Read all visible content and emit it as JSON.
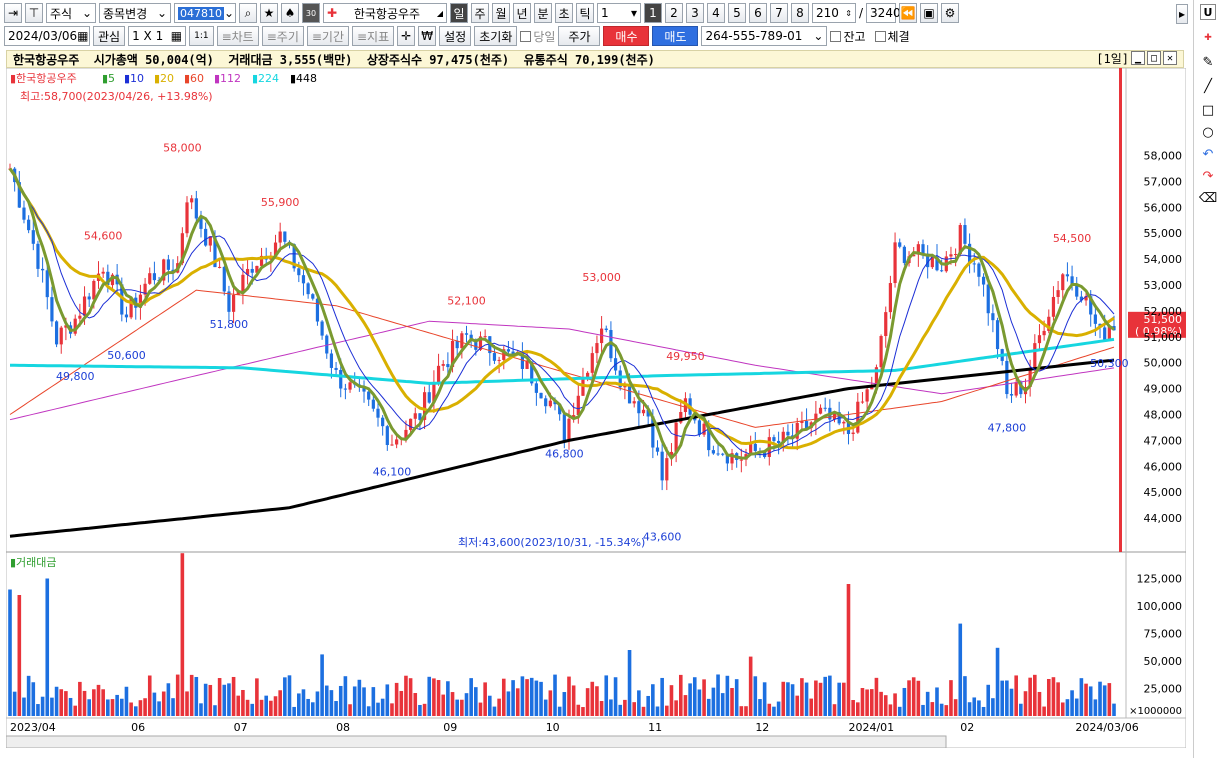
{
  "toolbar1": {
    "market": "주식",
    "change": "종목변경",
    "code": "047810",
    "stock_name": "한국항공우주",
    "periods": [
      "일",
      "주",
      "월",
      "년",
      "분",
      "초",
      "틱"
    ],
    "period_count": "1",
    "nums": [
      "1",
      "2",
      "3",
      "4",
      "5",
      "6",
      "7",
      "8"
    ],
    "count": "210",
    "slash": "/",
    "total": "3240",
    "u_label": "U"
  },
  "toolbar2": {
    "date": "2024/03/06",
    "watch": "관심",
    "grid": "1 X 1",
    "one": "1:1",
    "chart": "≡차트",
    "cycle": "≡주기",
    "range": "≡기간",
    "indicator": "≡지표",
    "won": "₩",
    "settings": "설정",
    "reset": "초기화",
    "sameday": "당일",
    "price": "주가",
    "buy": "매수",
    "sell": "매도",
    "account": "264-555-789-01",
    "balance": "잔고",
    "fill": "체결"
  },
  "info": {
    "text": "한국항공우주  시가총액 50,004(억)  거래대금 3,555(백만)  상장주식수 97,475(천주)  유통주식 70,199(천주)",
    "period": "[1일]"
  },
  "chart_data": [
    {
      "type": "line",
      "title": "",
      "legend_name": "한국항공우주",
      "ma": [
        {
          "name": "5",
          "color": "#2f9e2f"
        },
        {
          "name": "10",
          "color": "#1c2fd6"
        },
        {
          "name": "20",
          "color": "#d9b000"
        },
        {
          "name": "60",
          "color": "#e8452a"
        },
        {
          "name": "112",
          "color": "#c035c0"
        },
        {
          "name": "224",
          "color": "#16d6e0"
        },
        {
          "name": "448",
          "color": "#000000"
        }
      ],
      "high_note": "최고:58,700(2023/04/26, +13.98%)",
      "low_note": "최저:43,600(2023/10/31, -15.34%)",
      "ylim": [
        43000,
        59600
      ],
      "yticks": [
        44000,
        45000,
        46000,
        47000,
        48000,
        49000,
        50000,
        51000,
        52000,
        53000,
        54000,
        55000,
        56000,
        57000,
        58000
      ],
      "ytick_labels": [
        "44,000",
        "45,000",
        "46,000",
        "47,000",
        "48,000",
        "49,000",
        "50,000",
        "51,000",
        "52,000",
        "53,000",
        "54,000",
        "55,000",
        "56,000",
        "57,000",
        "58,000"
      ],
      "current_price": "51,500",
      "current_change": "( 0.98%)",
      "price_annotations": [
        {
          "label": "58,000",
          "i": 37,
          "v": 58000
        },
        {
          "label": "54,600",
          "i": 20,
          "v": 54600
        },
        {
          "label": "55,900",
          "i": 58,
          "v": 55900
        },
        {
          "label": "51,800",
          "i": 47,
          "v": 51800
        },
        {
          "label": "50,600",
          "i": 25,
          "v": 50600
        },
        {
          "label": "49,800",
          "i": 14,
          "v": 49800
        },
        {
          "label": "52,100",
          "i": 98,
          "v": 52100
        },
        {
          "label": "46,100",
          "i": 82,
          "v": 46100
        },
        {
          "label": "53,000",
          "i": 127,
          "v": 53000
        },
        {
          "label": "46,800",
          "i": 119,
          "v": 46800
        },
        {
          "label": "49,950",
          "i": 145,
          "v": 49950
        },
        {
          "label": "43,600",
          "i": 140,
          "v": 43600
        },
        {
          "label": "54,500",
          "i": 228,
          "v": 54500
        },
        {
          "label": "47,800",
          "i": 214,
          "v": 47800
        },
        {
          "label": "50,300",
          "i": 236,
          "v": 50300
        }
      ],
      "close_series": [
        {
          "i": 0,
          "v": 57500
        },
        {
          "i": 6,
          "v": 54000
        },
        {
          "i": 10,
          "v": 50900
        },
        {
          "i": 14,
          "v": 51700
        },
        {
          "i": 20,
          "v": 53800
        },
        {
          "i": 25,
          "v": 51800
        },
        {
          "i": 30,
          "v": 53300
        },
        {
          "i": 36,
          "v": 53800
        },
        {
          "i": 38,
          "v": 56500
        },
        {
          "i": 43,
          "v": 54500
        },
        {
          "i": 47,
          "v": 52200
        },
        {
          "i": 52,
          "v": 53800
        },
        {
          "i": 58,
          "v": 54900
        },
        {
          "i": 64,
          "v": 52700
        },
        {
          "i": 70,
          "v": 49500
        },
        {
          "i": 76,
          "v": 48500
        },
        {
          "i": 82,
          "v": 47000
        },
        {
          "i": 88,
          "v": 48000
        },
        {
          "i": 92,
          "v": 49800
        },
        {
          "i": 98,
          "v": 51000
        },
        {
          "i": 104,
          "v": 50500
        },
        {
          "i": 110,
          "v": 50000
        },
        {
          "i": 116,
          "v": 48500
        },
        {
          "i": 119,
          "v": 47300
        },
        {
          "i": 124,
          "v": 50000
        },
        {
          "i": 127,
          "v": 51500
        },
        {
          "i": 132,
          "v": 49000
        },
        {
          "i": 137,
          "v": 48000
        },
        {
          "i": 140,
          "v": 45500
        },
        {
          "i": 145,
          "v": 48500
        },
        {
          "i": 150,
          "v": 47000
        },
        {
          "i": 156,
          "v": 46300
        },
        {
          "i": 162,
          "v": 46700
        },
        {
          "i": 168,
          "v": 47100
        },
        {
          "i": 174,
          "v": 48000
        },
        {
          "i": 180,
          "v": 47300
        },
        {
          "i": 186,
          "v": 49600
        },
        {
          "i": 190,
          "v": 54300
        },
        {
          "i": 194,
          "v": 54200
        },
        {
          "i": 200,
          "v": 53800
        },
        {
          "i": 204,
          "v": 54900
        },
        {
          "i": 208,
          "v": 53600
        },
        {
          "i": 212,
          "v": 50700
        },
        {
          "i": 214,
          "v": 48700
        },
        {
          "i": 218,
          "v": 49200
        },
        {
          "i": 222,
          "v": 51600
        },
        {
          "i": 226,
          "v": 53500
        },
        {
          "i": 230,
          "v": 52800
        },
        {
          "i": 234,
          "v": 51000
        },
        {
          "i": 236,
          "v": 51500
        }
      ],
      "ma448_series": [
        {
          "i": 0,
          "v": 43300
        },
        {
          "i": 60,
          "v": 44400
        },
        {
          "i": 120,
          "v": 47000
        },
        {
          "i": 180,
          "v": 49000
        },
        {
          "i": 237,
          "v": 50100
        }
      ],
      "ma224_series": [
        {
          "i": 0,
          "v": 49900
        },
        {
          "i": 50,
          "v": 49800
        },
        {
          "i": 90,
          "v": 49200
        },
        {
          "i": 140,
          "v": 49500
        },
        {
          "i": 190,
          "v": 49700
        },
        {
          "i": 237,
          "v": 50900
        }
      ],
      "ma112_series": [
        {
          "i": 0,
          "v": 47800
        },
        {
          "i": 40,
          "v": 49500
        },
        {
          "i": 90,
          "v": 51600
        },
        {
          "i": 120,
          "v": 51300
        },
        {
          "i": 160,
          "v": 49900
        },
        {
          "i": 200,
          "v": 48800
        },
        {
          "i": 237,
          "v": 49800
        }
      ],
      "ma60_series": [
        {
          "i": 0,
          "v": 48000
        },
        {
          "i": 40,
          "v": 52800
        },
        {
          "i": 70,
          "v": 52200
        },
        {
          "i": 110,
          "v": 50100
        },
        {
          "i": 160,
          "v": 47500
        },
        {
          "i": 200,
          "v": 48500
        },
        {
          "i": 237,
          "v": 50600
        }
      ]
    },
    {
      "type": "bar",
      "title": "거래대금",
      "ylim": [
        0,
        140000
      ],
      "yticks": [
        25000,
        50000,
        75000,
        100000,
        125000
      ],
      "ytick_labels": [
        "25,000",
        "50,000",
        "75,000",
        "100,000",
        "125,000"
      ],
      "unit_label": "×1000000",
      "x_labels": [
        {
          "label": "2023/04",
          "i": 0
        },
        {
          "label": "06",
          "i": 26
        },
        {
          "label": "07",
          "i": 48
        },
        {
          "label": "08",
          "i": 70
        },
        {
          "label": "09",
          "i": 93
        },
        {
          "label": "10",
          "i": 115
        },
        {
          "label": "11",
          "i": 137
        },
        {
          "label": "12",
          "i": 160
        },
        {
          "label": "2024/01",
          "i": 180
        },
        {
          "label": "02",
          "i": 204
        },
        {
          "label": "2024/03/06",
          "i": 233
        }
      ],
      "spikes": [
        {
          "i": 0,
          "v": 115000,
          "up": false
        },
        {
          "i": 2,
          "v": 110000,
          "up": true
        },
        {
          "i": 8,
          "v": 125000,
          "up": false
        },
        {
          "i": 37,
          "v": 148000,
          "up": true
        },
        {
          "i": 67,
          "v": 56000,
          "up": false
        },
        {
          "i": 133,
          "v": 60000,
          "up": false
        },
        {
          "i": 159,
          "v": 54000,
          "up": true
        },
        {
          "i": 180,
          "v": 120000,
          "up": true
        },
        {
          "i": 204,
          "v": 84000,
          "up": false
        },
        {
          "i": 212,
          "v": 62000,
          "up": false
        }
      ]
    }
  ],
  "colors": {
    "up": "#e8333a",
    "down": "#1c6fe0"
  }
}
